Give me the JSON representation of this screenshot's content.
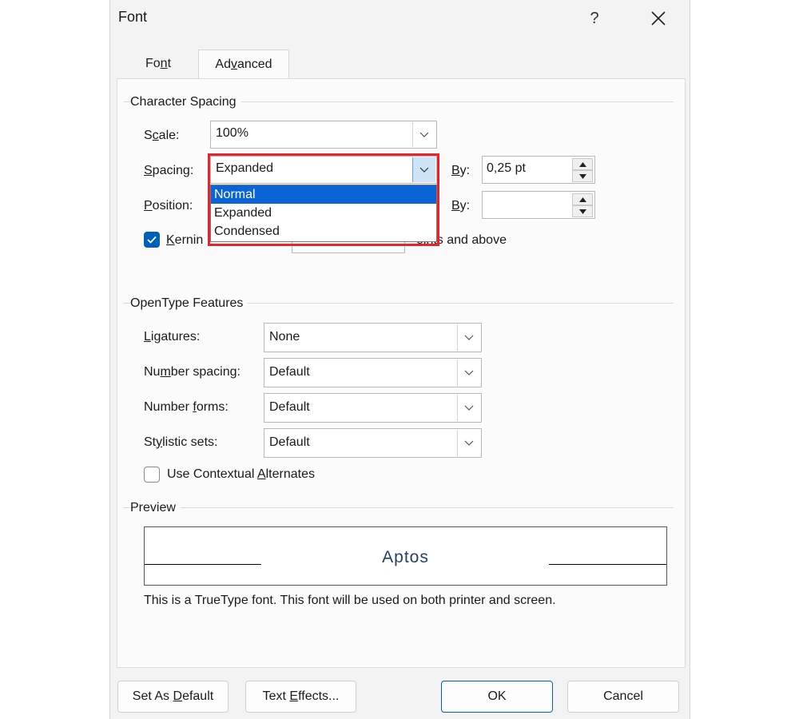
{
  "window": {
    "title": "Font",
    "help": "?"
  },
  "tabs": [
    {
      "label": "Font",
      "underline_index": 2
    },
    {
      "label": "Advanced",
      "underline_index": 2
    }
  ],
  "character_spacing": {
    "title": "Character Spacing",
    "scale": {
      "label_pre": "S",
      "label_u": "c",
      "label_post": "ale:",
      "value": "100%"
    },
    "spacing": {
      "label_pre": "",
      "label_u": "S",
      "label_post": "pacing:",
      "value": "Expanded",
      "by_label_u": "B",
      "by_label_post": "y:",
      "by_value": "0,25 pt"
    },
    "position": {
      "label_pre": "",
      "label_u": "P",
      "label_post": "osition:",
      "by_label_u": "B",
      "by_label_post": "y:",
      "by_value": ""
    },
    "kerning": {
      "label_u": "K",
      "label_visible": "ernin",
      "suffix": "oints and above",
      "checked": true
    },
    "dropdown_options": [
      "Normal",
      "Expanded",
      "Condensed"
    ],
    "dropdown_selected": "Normal"
  },
  "opentype": {
    "title": "OpenType Features",
    "ligatures": {
      "label_u": "L",
      "label_post": "igatures:",
      "value": "None"
    },
    "number_spacing": {
      "label_pre": "Nu",
      "label_u": "m",
      "label_post": "ber spacing:",
      "value": "Default"
    },
    "number_forms": {
      "label_pre": "Number ",
      "label_u": "f",
      "label_post": "orms:",
      "value": "Default"
    },
    "stylistic_sets": {
      "label_pre": "St",
      "label_u": "y",
      "label_post": "listic sets:",
      "value": "Default"
    },
    "contextual": {
      "label_pre": "Use Contextual ",
      "label_u": "A",
      "label_post": "lternates",
      "checked": false
    }
  },
  "preview": {
    "title": "Preview",
    "sample": "Aptos",
    "note": "This is a TrueType font. This font will be used on both printer and screen."
  },
  "buttons": {
    "set_default": {
      "pre": "Set As ",
      "u": "D",
      "post": "efault"
    },
    "text_effects": {
      "pre": "Text ",
      "u": "E",
      "post": "ffects..."
    },
    "ok": "OK",
    "cancel": "Cancel"
  },
  "colors": {
    "accent": "#005fb8",
    "highlight_border": "#e8232a",
    "selected_option": "#0a64d6"
  }
}
